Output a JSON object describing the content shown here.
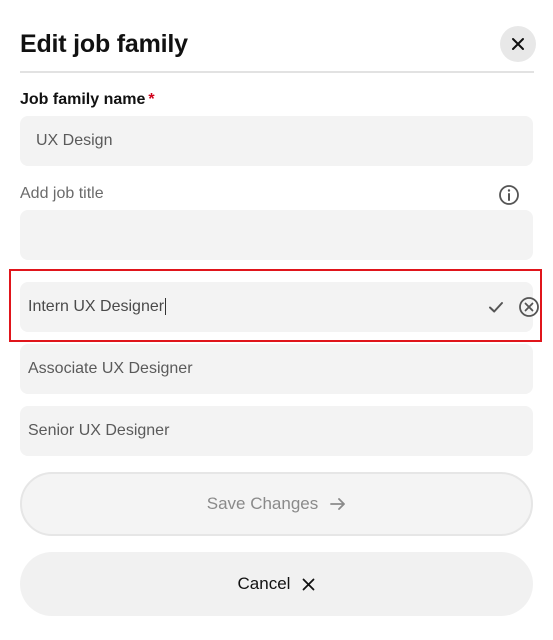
{
  "dialog": {
    "title": "Edit job family",
    "close_icon": "close-icon"
  },
  "job_family": {
    "label": "Job family name",
    "required_mark": "*",
    "value": "UX Design"
  },
  "add_job_title": {
    "label": "Add job title",
    "info_icon": "info-icon",
    "value": ""
  },
  "job_titles": {
    "editing": {
      "value": "Intern UX Designer",
      "confirm_icon": "check-icon",
      "remove_icon": "x-circle-icon"
    },
    "items": [
      {
        "label": "Associate UX Designer"
      },
      {
        "label": "Senior UX Designer"
      }
    ]
  },
  "actions": {
    "save_label": "Save Changes",
    "save_icon": "arrow-right-icon",
    "cancel_label": "Cancel",
    "cancel_icon": "close-icon"
  },
  "colors": {
    "required": "#d0021b",
    "highlight_border": "#e0151b",
    "field_bg": "#f3f3f3"
  }
}
